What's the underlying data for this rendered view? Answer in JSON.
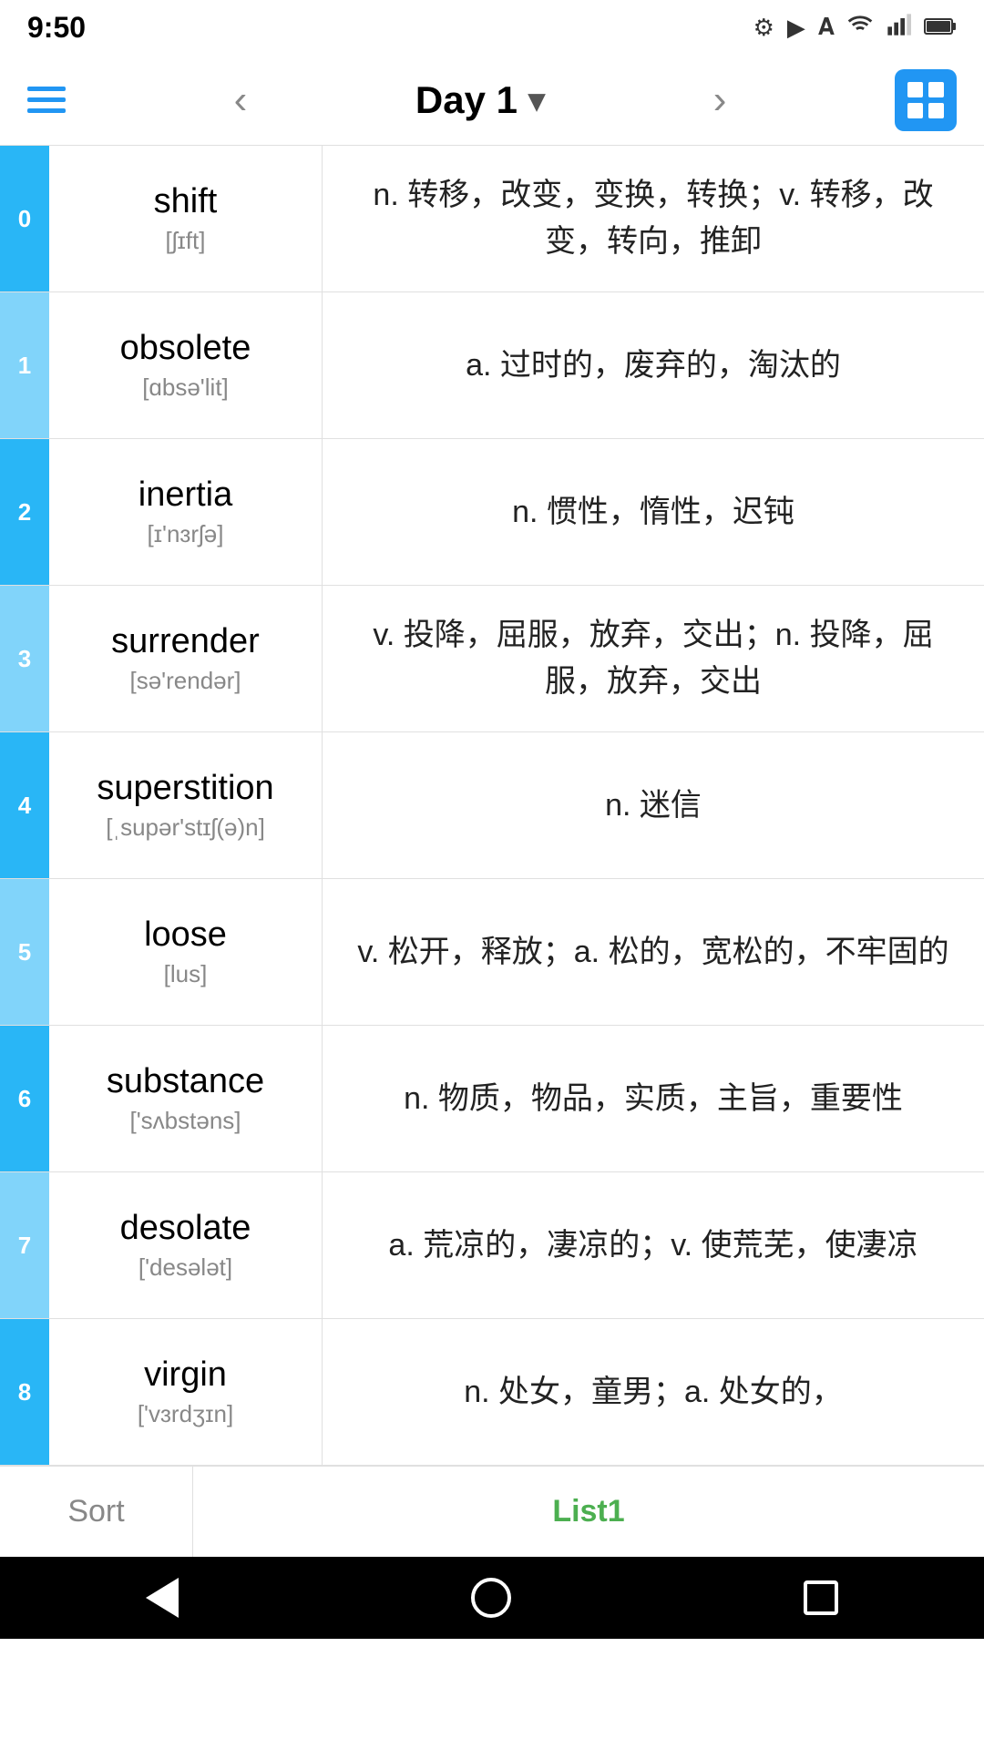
{
  "statusBar": {
    "time": "9:50",
    "icons": [
      "gear-icon",
      "play-icon",
      "font-icon",
      "wifi-icon",
      "signal-icon",
      "battery-icon"
    ]
  },
  "nav": {
    "title": "Day 1",
    "chevron": "▾",
    "back": "‹",
    "forward": "›",
    "grid_icon": "grid"
  },
  "words": [
    {
      "index": "0",
      "english": "shift",
      "phonetic": "[ʃɪft]",
      "definition": "n. 转移，改变，变换，转换；v. 转移，改变，转向，推卸"
    },
    {
      "index": "1",
      "english": "obsolete",
      "phonetic": "[ɑbsə'lit]",
      "definition": "a. 过时的，废弃的，淘汰的"
    },
    {
      "index": "2",
      "english": "inertia",
      "phonetic": "[ɪ'nɜrʃə]",
      "definition": "n. 惯性，惰性，迟钝"
    },
    {
      "index": "3",
      "english": "surrender",
      "phonetic": "[sə'rendər]",
      "definition": "v. 投降，屈服，放弃，交出；n. 投降，屈服，放弃，交出"
    },
    {
      "index": "4",
      "english": "superstition",
      "phonetic": "[ˌsupər'stɪʃ(ə)n]",
      "definition": "n. 迷信"
    },
    {
      "index": "5",
      "english": "loose",
      "phonetic": "[lus]",
      "definition": "v. 松开，释放；a. 松的，宽松的，不牢固的"
    },
    {
      "index": "6",
      "english": "substance",
      "phonetic": "['sʌbstəns]",
      "definition": "n. 物质，物品，实质，主旨，重要性"
    },
    {
      "index": "7",
      "english": "desolate",
      "phonetic": "['desələt]",
      "definition": "a. 荒凉的，凄凉的；v. 使荒芜，使凄凉"
    },
    {
      "index": "8",
      "english": "virgin",
      "phonetic": "['vɜrdʒɪn]",
      "definition": "n. 处女，童男；a. 处女的，"
    }
  ],
  "bottomTabs": {
    "sort": "Sort",
    "list1": "List1"
  },
  "androidNav": {
    "back": "back",
    "home": "home",
    "recent": "recent"
  }
}
